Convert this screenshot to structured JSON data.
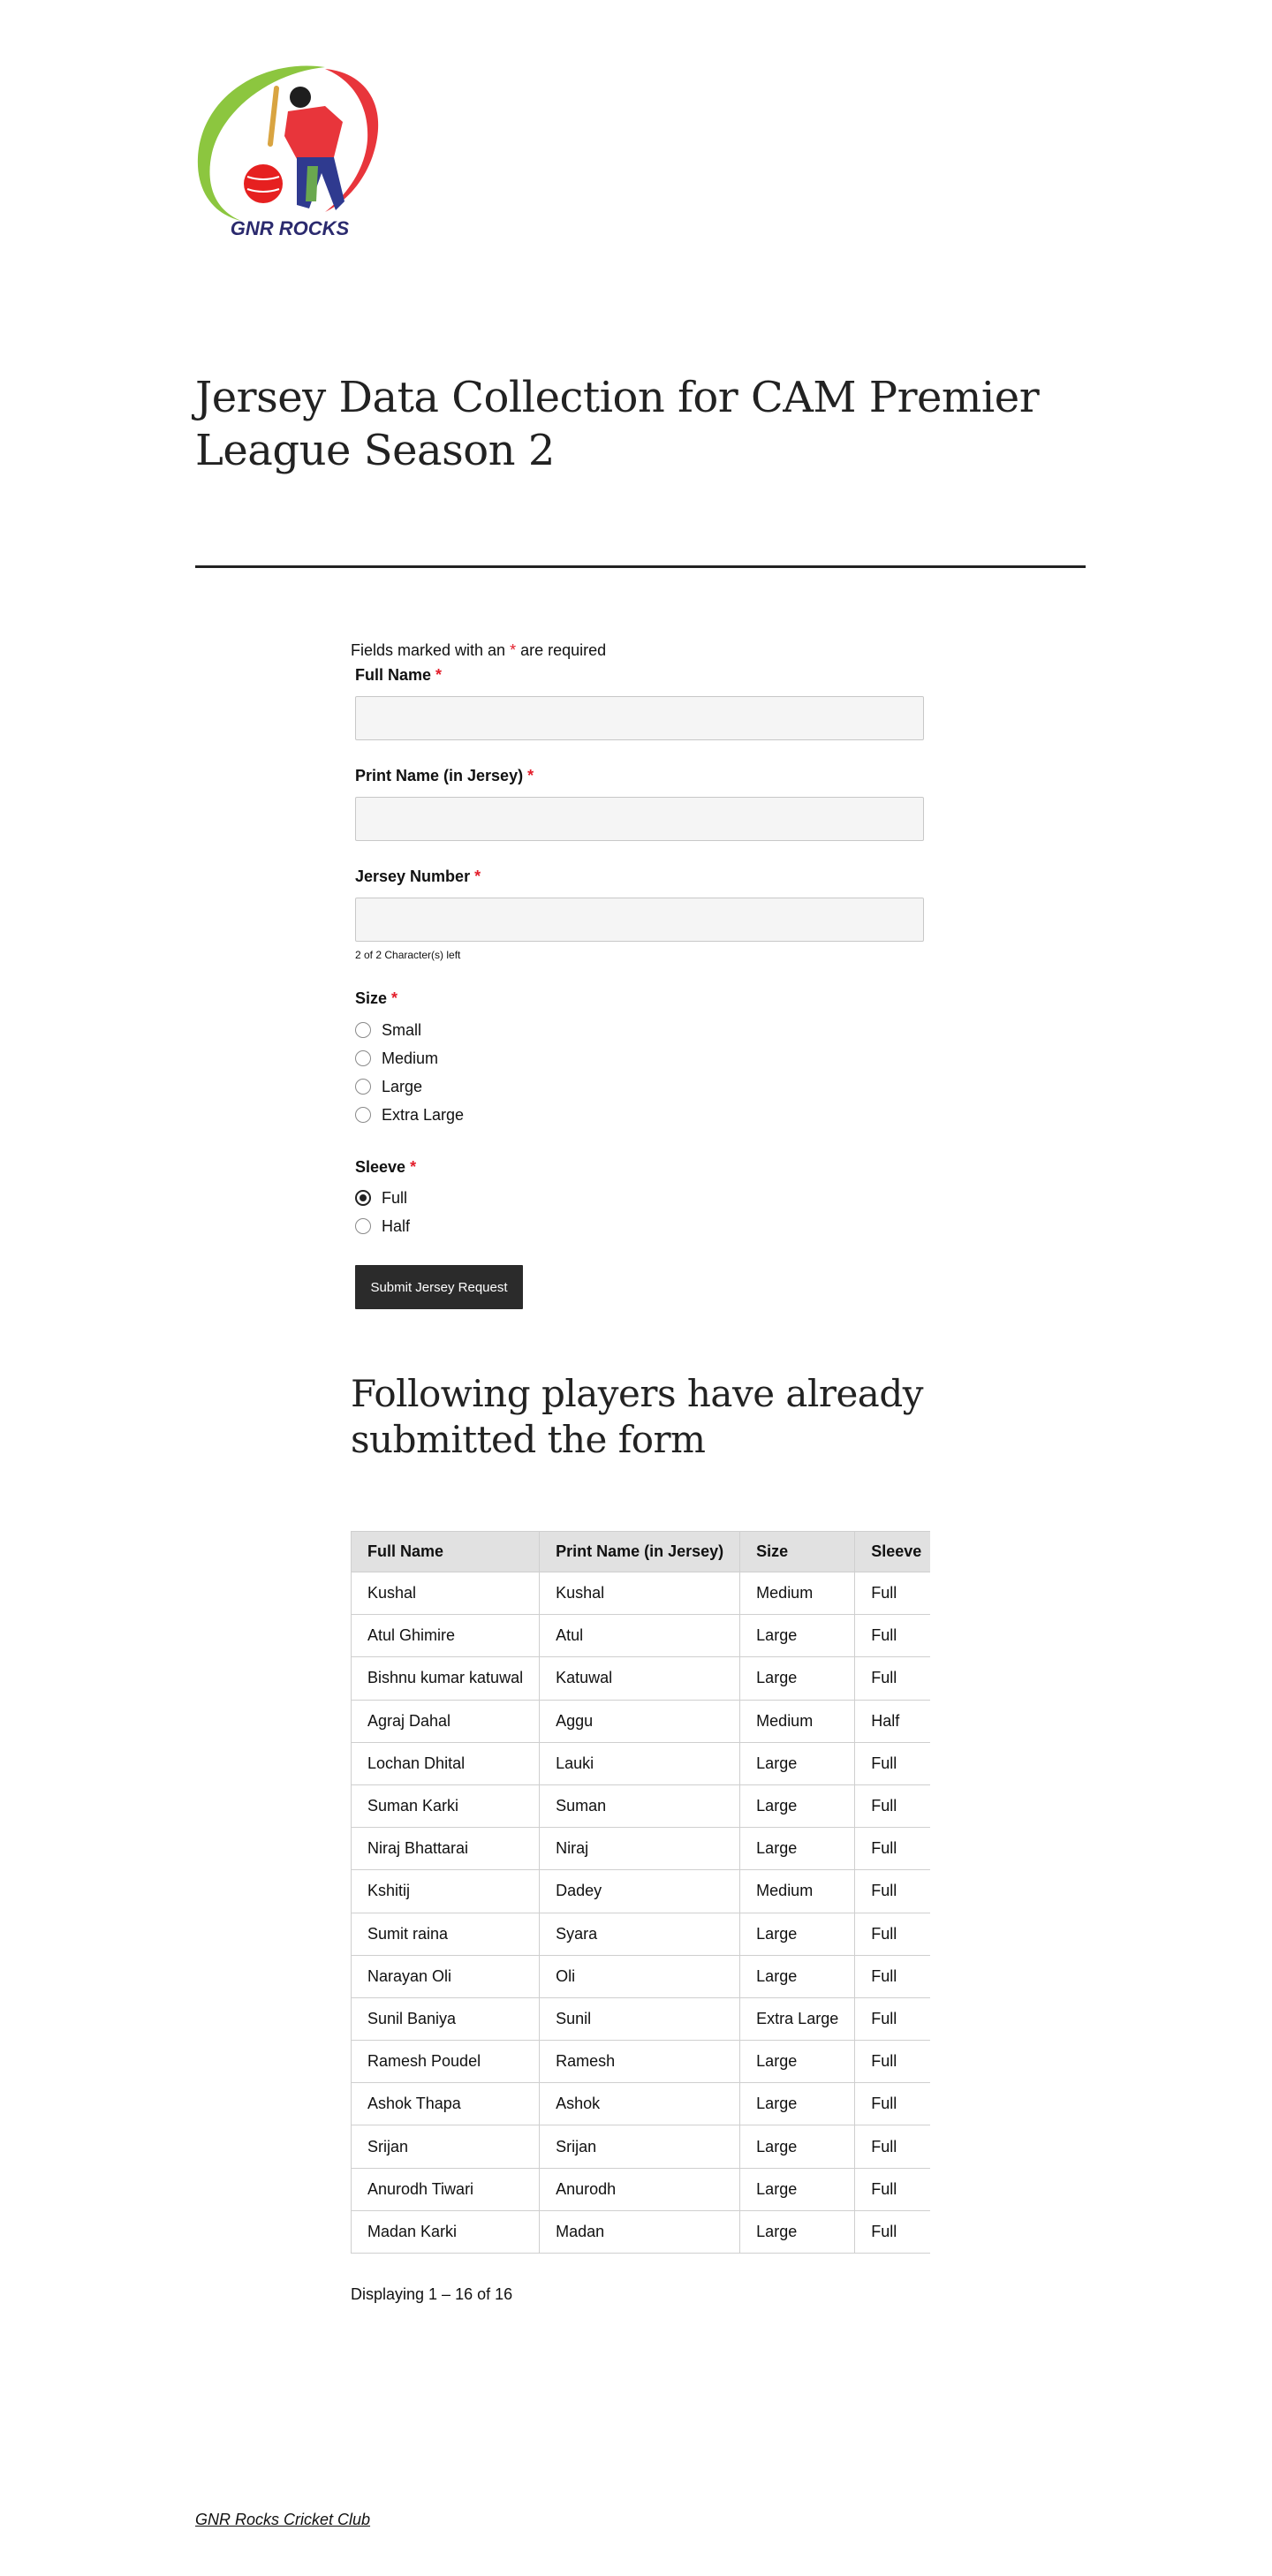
{
  "logo": {
    "text": "GNR ROCKS"
  },
  "page": {
    "title": "Jersey Data Collection for CAM Premier League Season 2"
  },
  "form": {
    "required_note_prefix": "Fields marked with an ",
    "required_note_star": "*",
    "required_note_suffix": " are required",
    "full_name_label": "Full Name",
    "full_name_value": "",
    "print_name_label": "Print Name (in Jersey)",
    "print_name_value": "",
    "jersey_number_label": "Jersey Number",
    "jersey_number_value": "",
    "char_count": "2 of 2 Character(s) left",
    "required_star": "*",
    "size_label": "Size",
    "size_options": [
      "Small",
      "Medium",
      "Large",
      "Extra Large"
    ],
    "sleeve_label": "Sleeve",
    "sleeve_options": [
      "Full",
      "Half"
    ],
    "sleeve_selected": "Full",
    "submit_label": "Submit Jersey Request"
  },
  "submissions": {
    "heading": "Following players have already submitted the form",
    "columns": [
      "Full Name",
      "Print Name (in Jersey)",
      "Size",
      "Sleeve"
    ],
    "rows": [
      [
        "Kushal",
        "Kushal",
        "Medium",
        "Full"
      ],
      [
        "Atul Ghimire",
        "Atul",
        "Large",
        "Full"
      ],
      [
        "Bishnu kumar katuwal",
        "Katuwal",
        "Large",
        "Full"
      ],
      [
        "Agraj Dahal",
        "Aggu",
        "Medium",
        "Half"
      ],
      [
        "Lochan Dhital",
        "Lauki",
        "Large",
        "Full"
      ],
      [
        "Suman Karki",
        "Suman",
        "Large",
        "Full"
      ],
      [
        "Niraj Bhattarai",
        "Niraj",
        "Large",
        "Full"
      ],
      [
        "Kshitij",
        "Dadey",
        "Medium",
        "Full"
      ],
      [
        "Sumit raina",
        "Syara",
        "Large",
        "Full"
      ],
      [
        "Narayan Oli",
        "Oli",
        "Large",
        "Full"
      ],
      [
        "Sunil Baniya",
        "Sunil",
        "Extra Large",
        "Full"
      ],
      [
        "Ramesh Poudel",
        "Ramesh",
        "Large",
        "Full"
      ],
      [
        "Ashok Thapa",
        "Ashok",
        "Large",
        "Full"
      ],
      [
        "Srijan",
        "Srijan",
        "Large",
        "Full"
      ],
      [
        "Anurodh Tiwari",
        "Anurodh",
        "Large",
        "Full"
      ],
      [
        "Madan Karki",
        "Madan",
        "Large",
        "Full"
      ]
    ],
    "pagination": "Displaying 1 – 16 of 16"
  },
  "footer": {
    "site_name": "GNR Rocks Cricket Club"
  },
  "colors": {
    "required": "#e31e2b",
    "button_bg": "#2b2b2b",
    "input_bg": "#f5f5f5",
    "header_bg": "#e1e1e1"
  }
}
